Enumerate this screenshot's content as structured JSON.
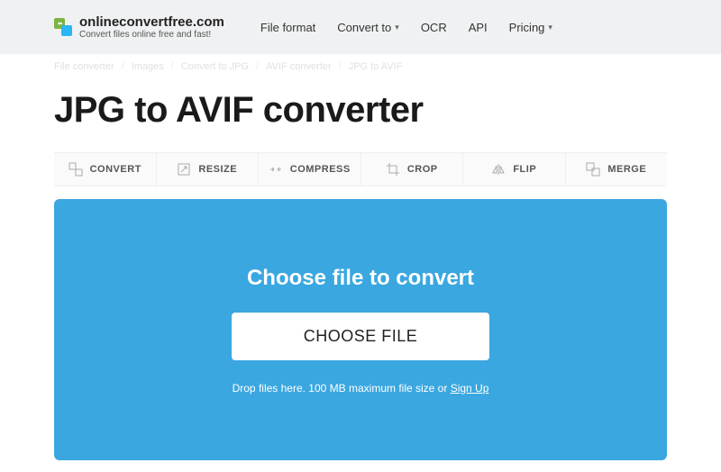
{
  "logo": {
    "title": "onlineconvertfree.com",
    "sub": "Convert files online free and fast!"
  },
  "nav": {
    "file_format": "File format",
    "convert_to": "Convert to",
    "ocr": "OCR",
    "api": "API",
    "pricing": "Pricing"
  },
  "breadcrumb": {
    "b0": "File converter",
    "b1": "Images",
    "b2": "Convert to JPG",
    "b3": "AVIF converter",
    "b4": "JPG to AVIF"
  },
  "page_title": "JPG to AVIF converter",
  "toolbar": {
    "convert": "CONVERT",
    "resize": "RESIZE",
    "compress": "COMPRESS",
    "crop": "CROP",
    "flip": "FLIP",
    "merge": "MERGE"
  },
  "drop": {
    "title": "Choose file to convert",
    "button": "CHOOSE FILE",
    "hint_prefix": "Drop files here. 100 MB maximum file size or ",
    "hint_link": "Sign Up"
  }
}
